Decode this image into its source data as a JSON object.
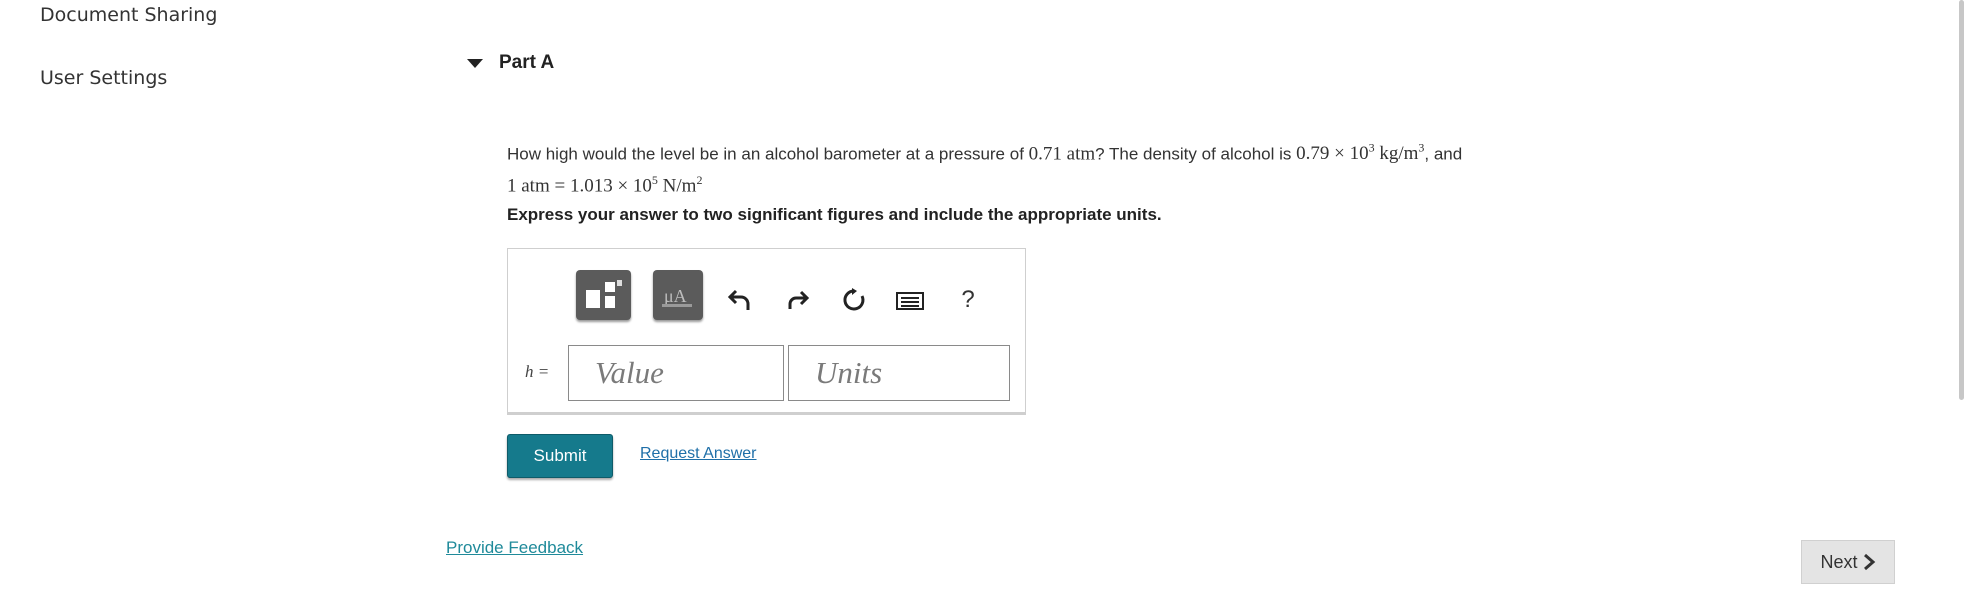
{
  "sidebar": {
    "items": [
      {
        "label": "Document Sharing"
      },
      {
        "label": "User Settings"
      }
    ]
  },
  "part": {
    "title": "Part A"
  },
  "question": {
    "text_1": "How high would the level be in an alcohol barometer at a pressure of ",
    "pressure": "0.71 atm",
    "text_2": "? The density of alcohol is ",
    "density": "0.79 × 10",
    "density_exp": "3",
    "density_units": " kg/m",
    "density_units_exp": "3",
    "text_3": ", and",
    "line2_a": "1 atm = 1.013 × 10",
    "line2_exp": "5",
    "line2_b": " N/m",
    "line2_exp2": "2"
  },
  "instruction": "Express your answer to two significant figures and include the appropriate units.",
  "toolbar": {
    "tools": [
      {
        "icon": "templates-icon"
      },
      {
        "icon": "units-icon"
      },
      {
        "icon": "undo-icon"
      },
      {
        "icon": "redo-icon"
      },
      {
        "icon": "reset-icon"
      },
      {
        "icon": "keyboard-icon"
      },
      {
        "icon": "help-icon",
        "glyph": "?"
      }
    ]
  },
  "answer": {
    "label": "h =",
    "value_placeholder": "Value",
    "units_placeholder": "Units"
  },
  "actions": {
    "submit_label": "Submit",
    "request_answer_label": "Request Answer"
  },
  "footer": {
    "feedback_label": "Provide Feedback",
    "next_label": "Next"
  },
  "colors": {
    "submit_bg": "#157a8c",
    "link": "#1f6fa8",
    "tool_bg": "#5b5b5b"
  }
}
